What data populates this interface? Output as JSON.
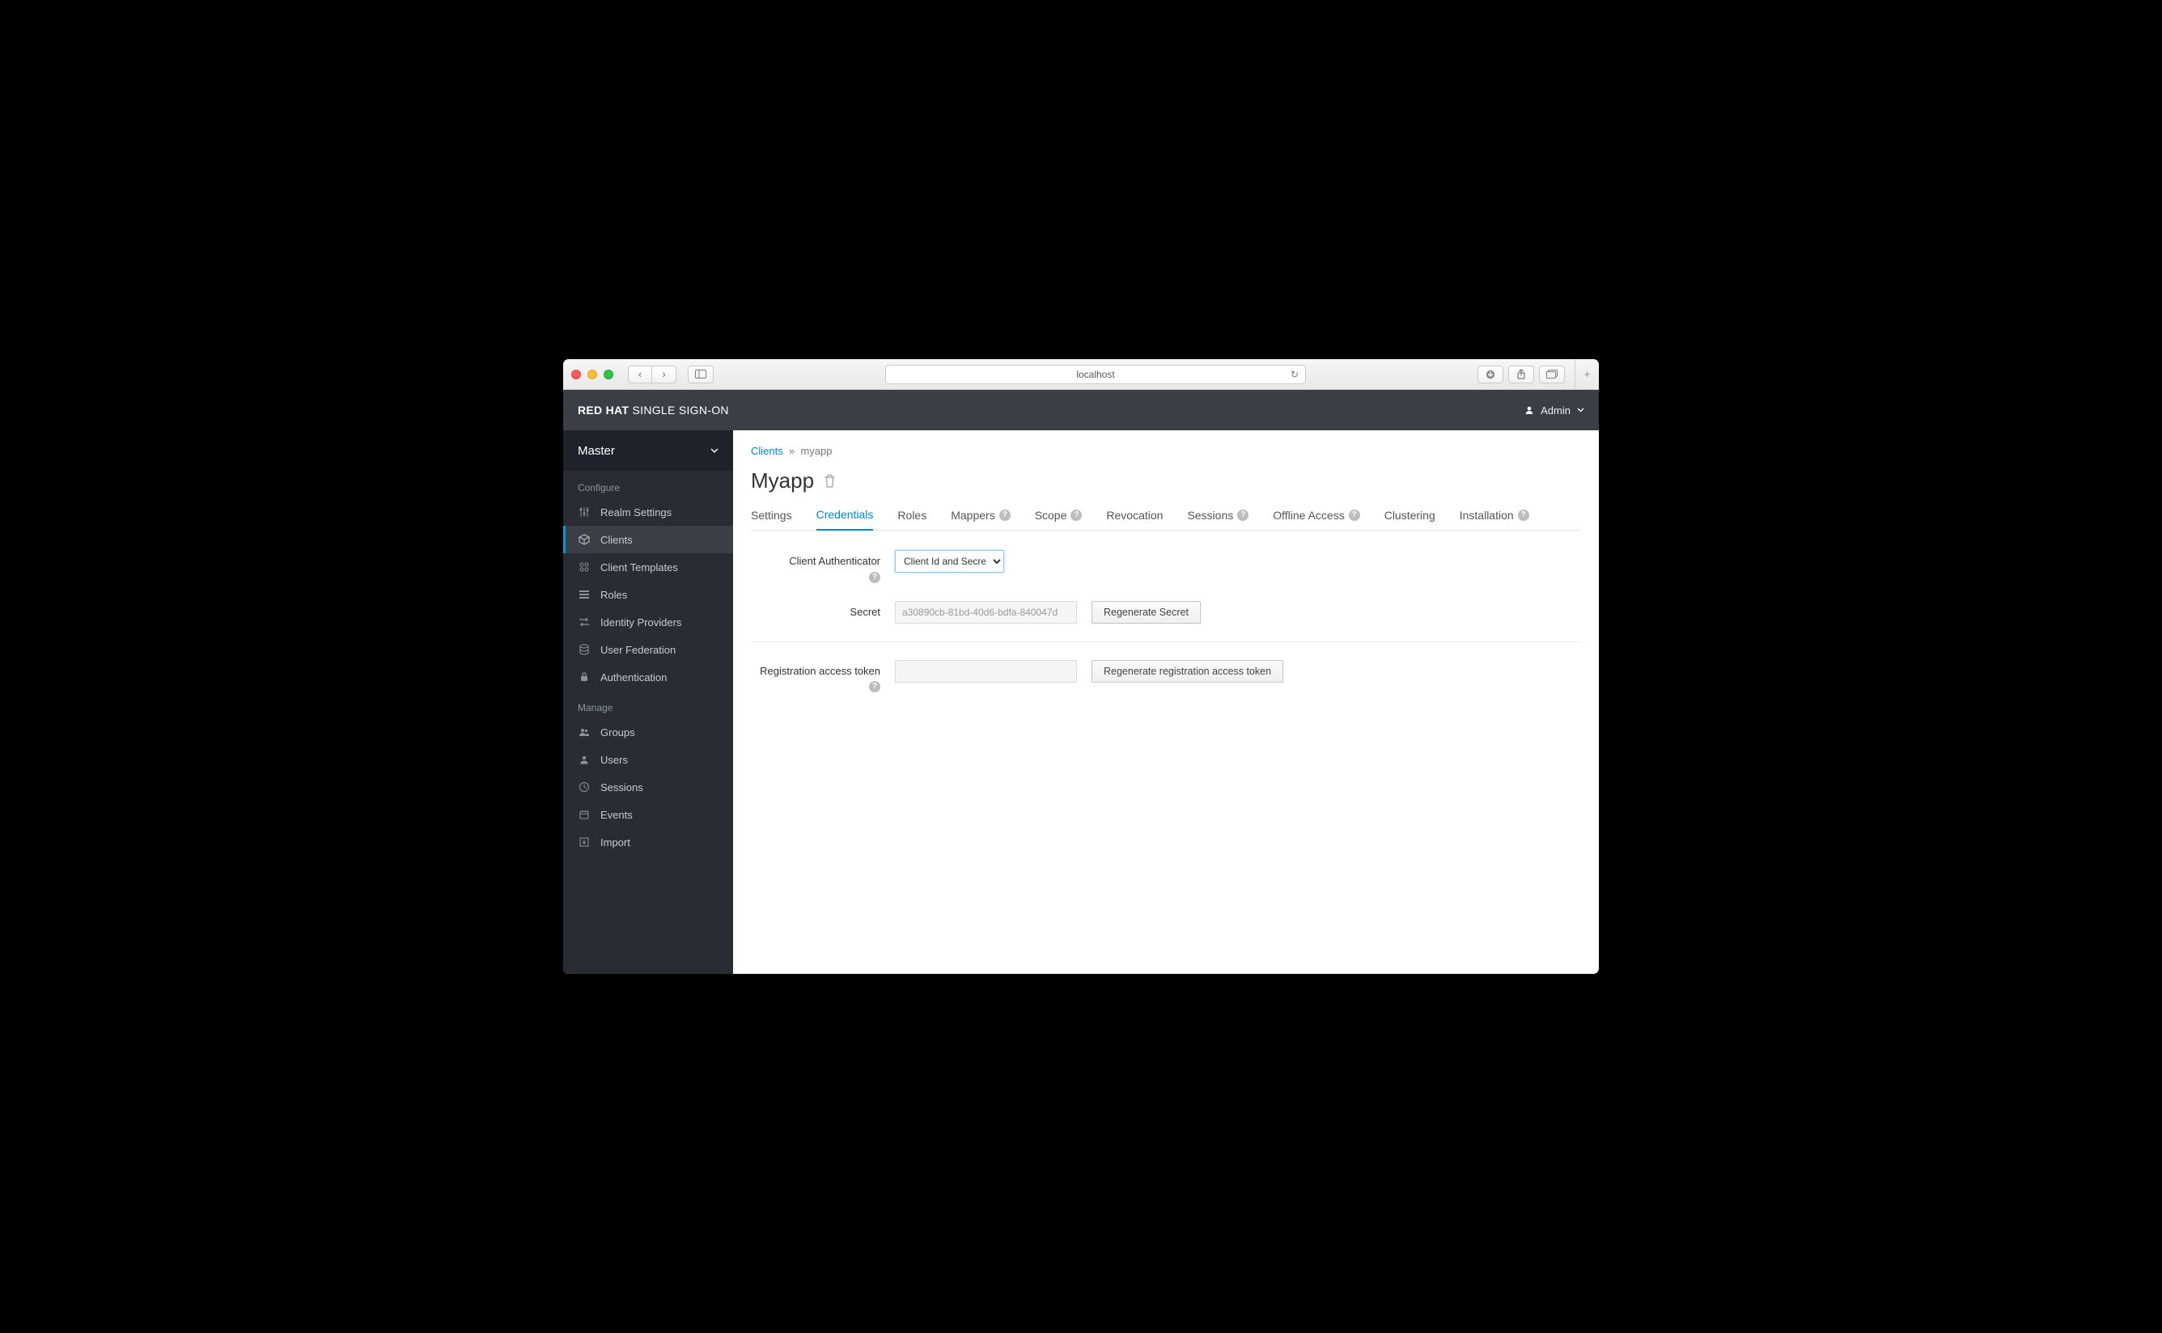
{
  "browser": {
    "address": "localhost"
  },
  "header": {
    "brand_bold": "RED HAT",
    "brand_light": "SINGLE SIGN-ON",
    "user": "Admin"
  },
  "sidebar": {
    "realm": "Master",
    "section_configure": "Configure",
    "section_manage": "Manage",
    "items_configure": [
      {
        "label": "Realm Settings"
      },
      {
        "label": "Clients"
      },
      {
        "label": "Client Templates"
      },
      {
        "label": "Roles"
      },
      {
        "label": "Identity Providers"
      },
      {
        "label": "User Federation"
      },
      {
        "label": "Authentication"
      }
    ],
    "items_manage": [
      {
        "label": "Groups"
      },
      {
        "label": "Users"
      },
      {
        "label": "Sessions"
      },
      {
        "label": "Events"
      },
      {
        "label": "Import"
      }
    ]
  },
  "breadcrumb": {
    "parent": "Clients",
    "sep": "»",
    "current": "myapp"
  },
  "page": {
    "title": "Myapp"
  },
  "tabs": [
    {
      "label": "Settings",
      "help": false
    },
    {
      "label": "Credentials",
      "help": false
    },
    {
      "label": "Roles",
      "help": false
    },
    {
      "label": "Mappers",
      "help": true
    },
    {
      "label": "Scope",
      "help": true
    },
    {
      "label": "Revocation",
      "help": false
    },
    {
      "label": "Sessions",
      "help": true
    },
    {
      "label": "Offline Access",
      "help": true
    },
    {
      "label": "Clustering",
      "help": false
    },
    {
      "label": "Installation",
      "help": true
    }
  ],
  "form": {
    "authenticator_label": "Client Authenticator",
    "authenticator_value": "Client Id and Secret",
    "secret_label": "Secret",
    "secret_value": "a30890cb-81bd-40d6-bdfa-840047d",
    "regen_secret": "Regenerate Secret",
    "reg_token_label": "Registration access token",
    "regen_token": "Regenerate registration access token"
  }
}
